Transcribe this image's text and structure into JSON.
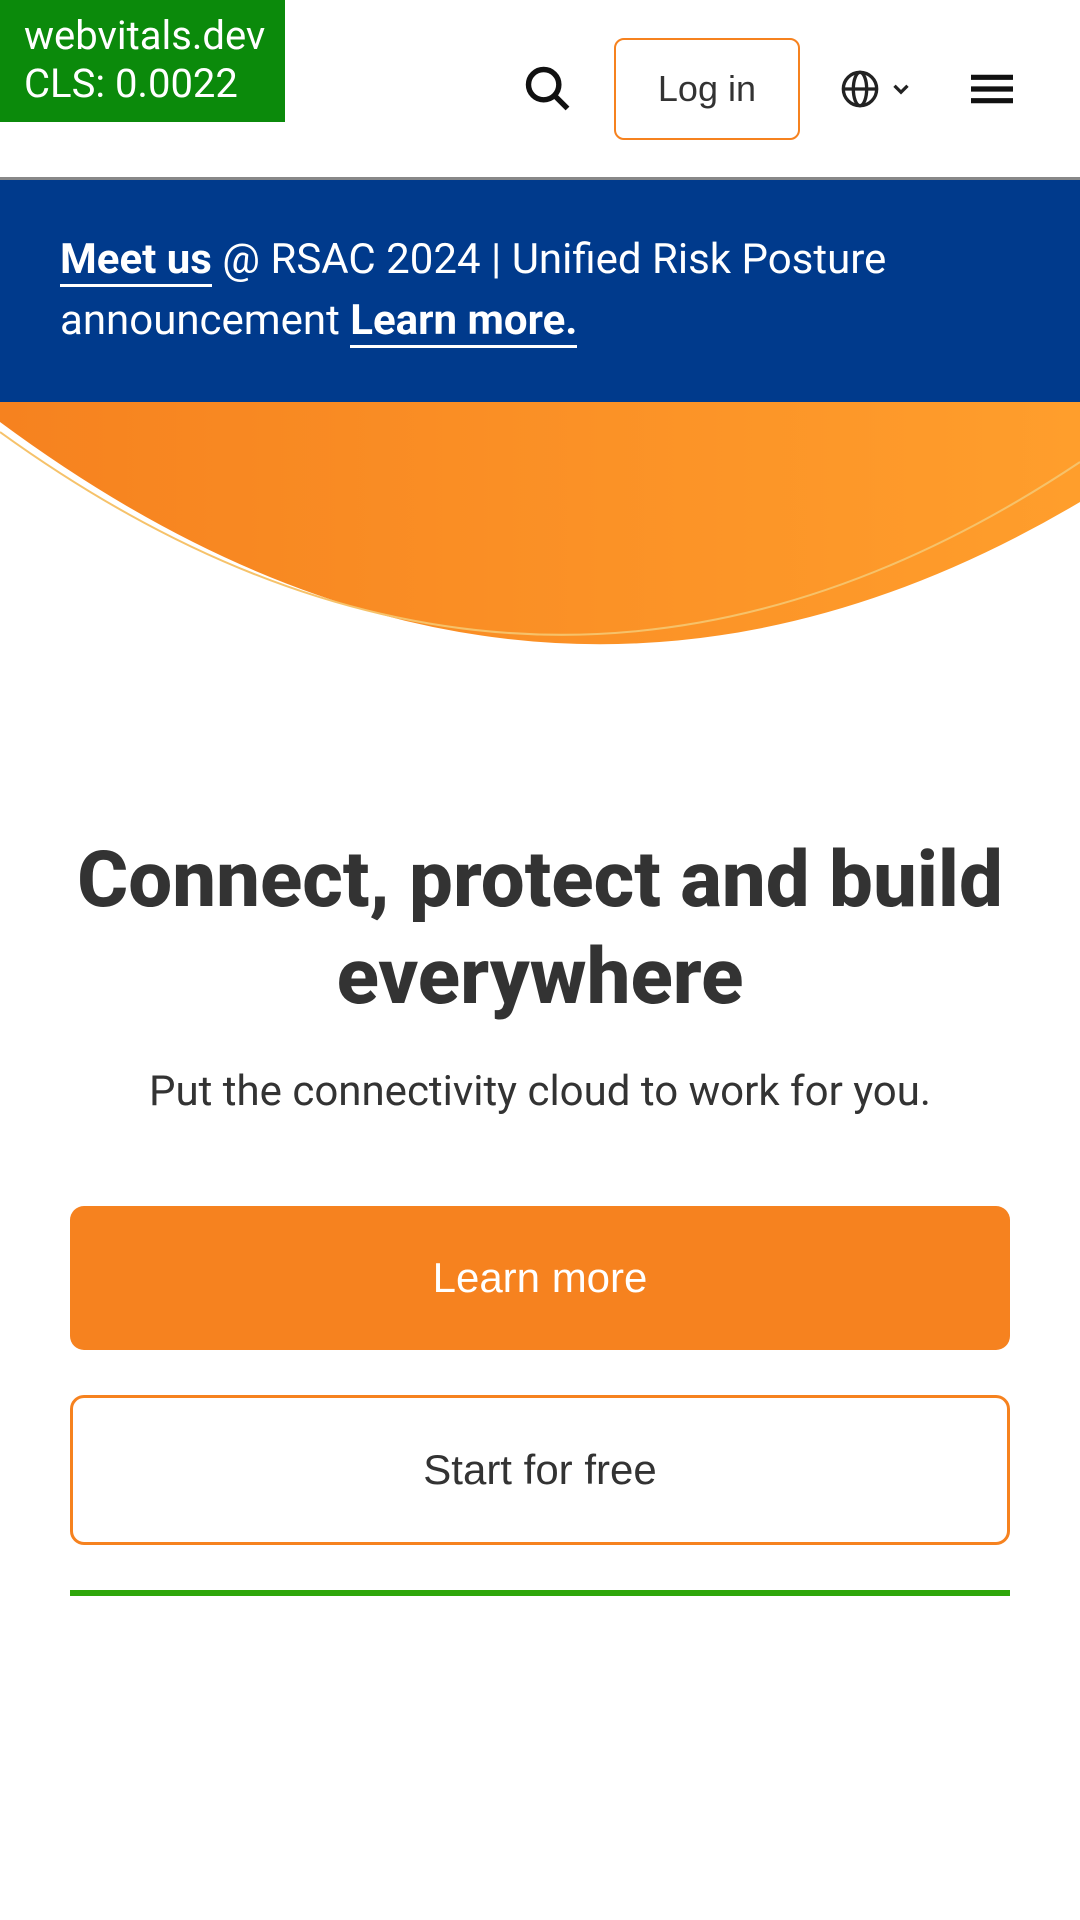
{
  "vitals": {
    "line1": "webvitals.dev",
    "line2": "CLS: 0.0022"
  },
  "nav": {
    "login": "Log in"
  },
  "banner": {
    "meet_us": "Meet us",
    "middle": " @ RSAC 2024 | Unified Risk Posture announcement  ",
    "learn_more": "Learn more."
  },
  "hero": {
    "headline": "Connect, protect and build everywhere",
    "sub": "Put the connectivity cloud to work for you.",
    "cta_primary": "Learn more",
    "cta_secondary": "Start for free"
  }
}
